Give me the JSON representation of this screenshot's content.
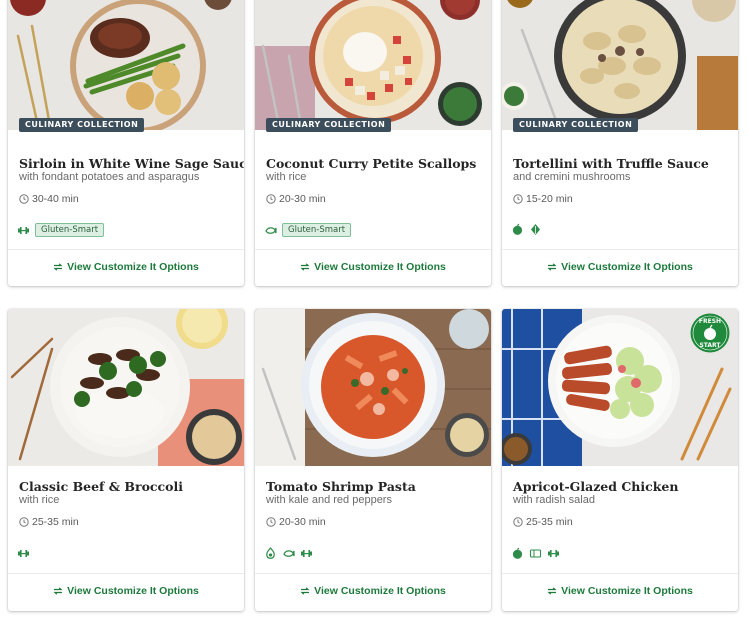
{
  "action_label": "View Customize It Options",
  "colors": {
    "accent_green": "#1e7a3c",
    "badge_bg": "#3c4d5c",
    "pill_bg": "#dcefe2"
  },
  "cards": [
    {
      "badge": "CULINARY COLLECTION",
      "title": "Sirloin in White Wine Sage Sauce",
      "subtitle": "with fondant potatoes and asparagus",
      "time": "30-40 min",
      "tag_icons": [
        "protein-icon"
      ],
      "pill": "Gluten-Smart"
    },
    {
      "badge": "CULINARY COLLECTION",
      "title": "Coconut Curry Petite Scallops",
      "subtitle": "with rice",
      "time": "20-30 min",
      "tag_icons": [
        "seafood-icon"
      ],
      "pill": "Gluten-Smart"
    },
    {
      "badge": "CULINARY COLLECTION",
      "title": "Tortellini with Truffle Sauce",
      "subtitle": "and cremini mushrooms",
      "time": "15-20 min",
      "tag_icons": [
        "veggie-icon",
        "leaf-icon"
      ],
      "pill": ""
    },
    {
      "badge": "",
      "title": "Classic Beef & Broccoli",
      "subtitle": "with rice",
      "time": "25-35 min",
      "tag_icons": [
        "protein-icon"
      ],
      "pill": ""
    },
    {
      "badge": "",
      "title": "Tomato Shrimp Pasta",
      "subtitle": "with kale and red peppers",
      "time": "20-30 min",
      "tag_icons": [
        "calorie-icon",
        "seafood-icon",
        "protein-icon"
      ],
      "pill": ""
    },
    {
      "badge": "",
      "title": "Apricot-Glazed Chicken",
      "subtitle": "with radish salad",
      "time": "25-35 min",
      "tag_icons": [
        "veggie-icon",
        "easy-prep-icon",
        "protein-icon"
      ],
      "pill": "",
      "fresh_badge": "FRESH START"
    }
  ]
}
